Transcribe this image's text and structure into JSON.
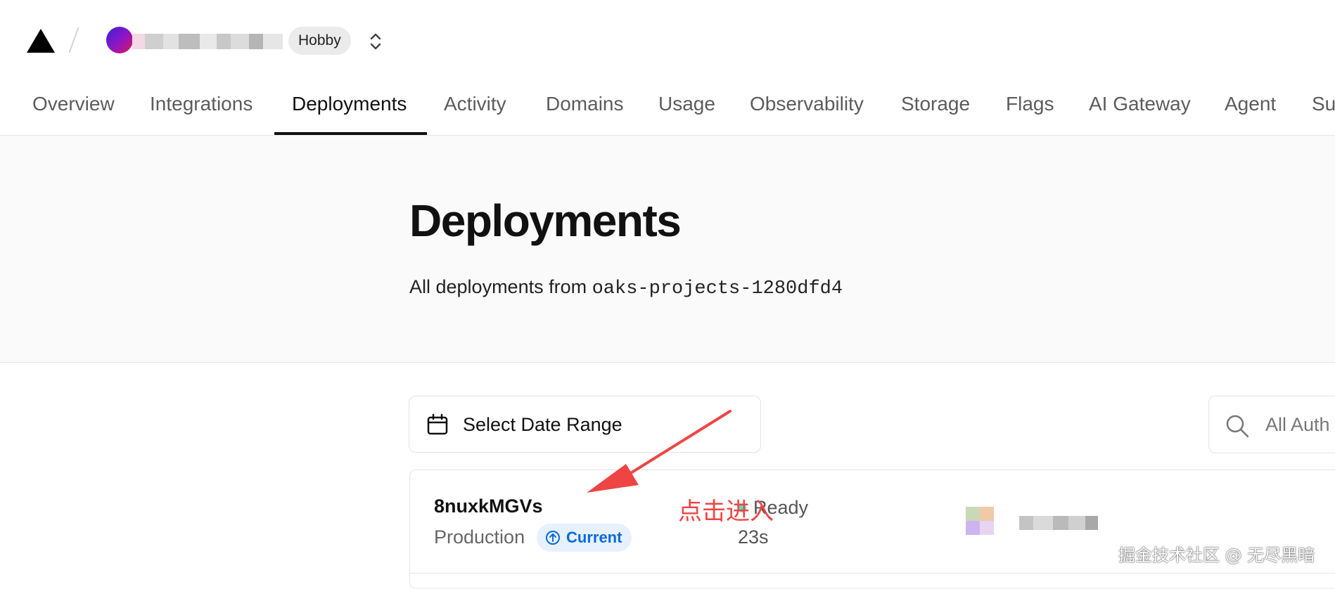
{
  "header": {
    "team_plan": "Hobby"
  },
  "tabs": [
    {
      "label": "Overview",
      "active": false
    },
    {
      "label": "Integrations",
      "active": false
    },
    {
      "label": "Deployments",
      "active": true
    },
    {
      "label": "Activity",
      "active": false
    },
    {
      "label": "Domains",
      "active": false
    },
    {
      "label": "Usage",
      "active": false
    },
    {
      "label": "Observability",
      "active": false
    },
    {
      "label": "Storage",
      "active": false
    },
    {
      "label": "Flags",
      "active": false
    },
    {
      "label": "AI Gateway",
      "active": false
    },
    {
      "label": "Agent",
      "active": false
    },
    {
      "label": "Su",
      "active": false
    }
  ],
  "page": {
    "title": "Deployments",
    "subtitle_prefix": "All deployments from ",
    "scope_name": "oaks-projects-1280dfd4"
  },
  "filters": {
    "date_range_label": "Select Date Range",
    "author_search_placeholder": "All Auth"
  },
  "deployments": [
    {
      "id": "8nuxkMGVs",
      "environment": "Production",
      "current_label": "Current",
      "status": "Ready",
      "status_color": "#50e3c2",
      "duration": "23s"
    }
  ],
  "annotation": {
    "text": "点击进入",
    "color": "#ef4444"
  },
  "watermark": "掘金技术社区 @ 无尽黑暗",
  "colors": {
    "accent_blue": "#0a6ad9",
    "active_tab": "#111111",
    "inactive_tab": "#5c5c5c"
  },
  "icons": {
    "logo": "triangle-logo-icon",
    "switcher": "chevron-up-down-icon",
    "calendar": "calendar-icon",
    "search": "search-icon",
    "current": "arrow-up-circle-icon"
  }
}
